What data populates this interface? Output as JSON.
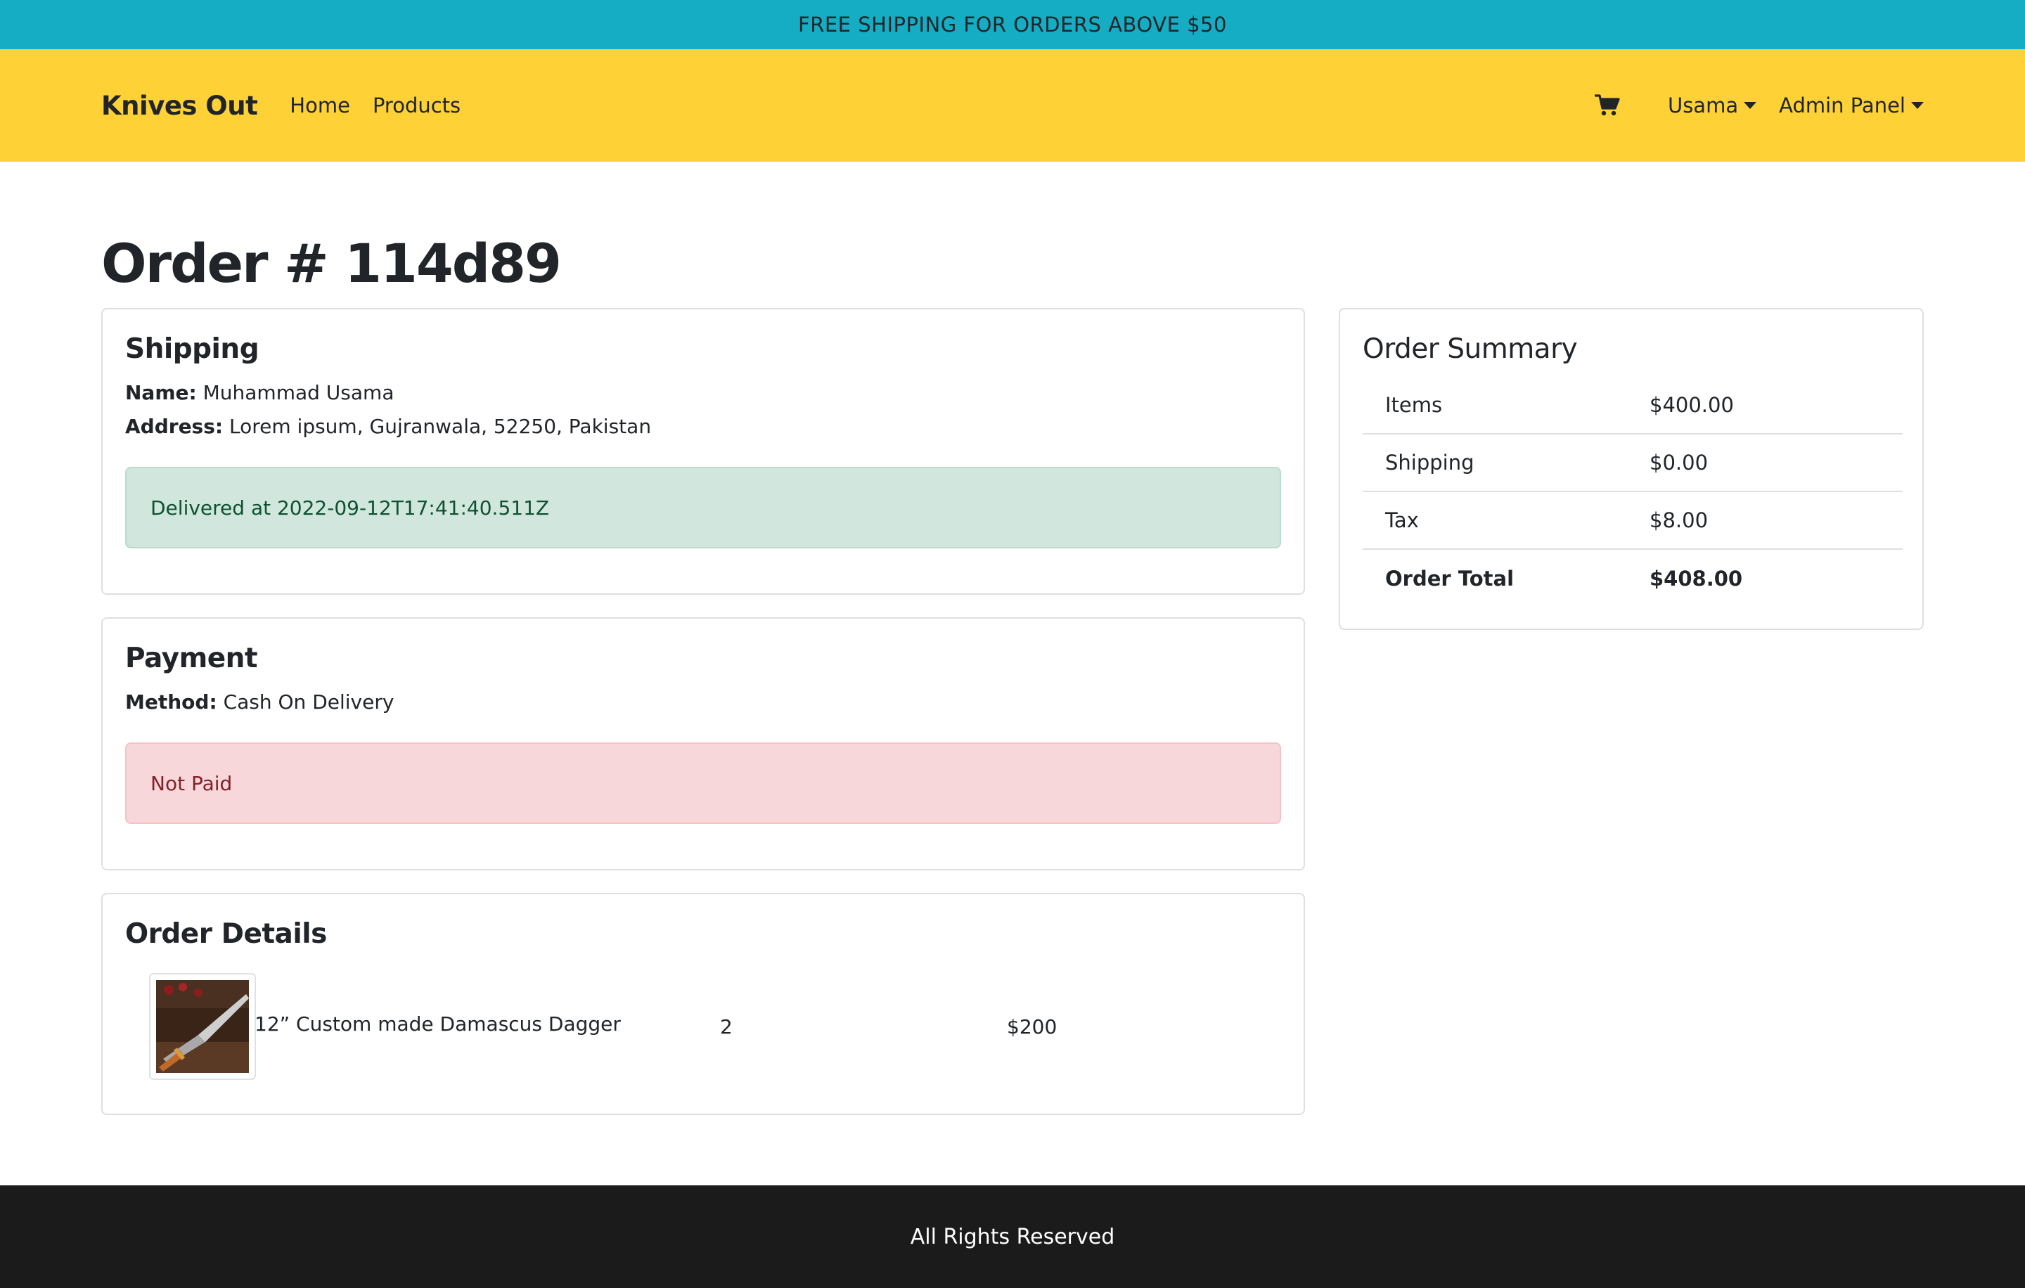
{
  "promo": {
    "text": "FREE SHIPPING FOR ORDERS ABOVE $50"
  },
  "nav": {
    "brand": "Knives Out",
    "links": [
      "Home",
      "Products"
    ],
    "cart_icon": "shopping-cart-icon",
    "user_menu": "Usama",
    "admin_menu": "Admin Panel"
  },
  "page": {
    "title": "Order # 114d89"
  },
  "shipping": {
    "heading": "Shipping",
    "name_label": "Name:",
    "name_value": "Muhammad Usama",
    "address_label": "Address:",
    "address_value": "Lorem ipsum, Gujranwala, 52250, Pakistan",
    "status": "Delivered at 2022-09-12T17:41:40.511Z"
  },
  "payment": {
    "heading": "Payment",
    "method_label": "Method:",
    "method_value": "Cash On Delivery",
    "status": "Not Paid"
  },
  "order_details": {
    "heading": "Order Details",
    "items": [
      {
        "name": "12” Custom made Damascus Dagger",
        "qty": "2",
        "price": "$200"
      }
    ]
  },
  "summary": {
    "heading": "Order Summary",
    "rows": [
      {
        "label": "Items",
        "value": "$400.00"
      },
      {
        "label": "Shipping",
        "value": "$0.00"
      },
      {
        "label": "Tax",
        "value": "$8.00"
      },
      {
        "label": "Order Total",
        "value": "$408.00"
      }
    ]
  },
  "footer": {
    "text": "All Rights Reserved"
  },
  "colors": {
    "promo_bg": "#14adc4",
    "navbar_bg": "#fed136",
    "success_bg": "#d1e7dd",
    "danger_bg": "#f8d7da",
    "footer_bg": "#1b1b1b"
  }
}
